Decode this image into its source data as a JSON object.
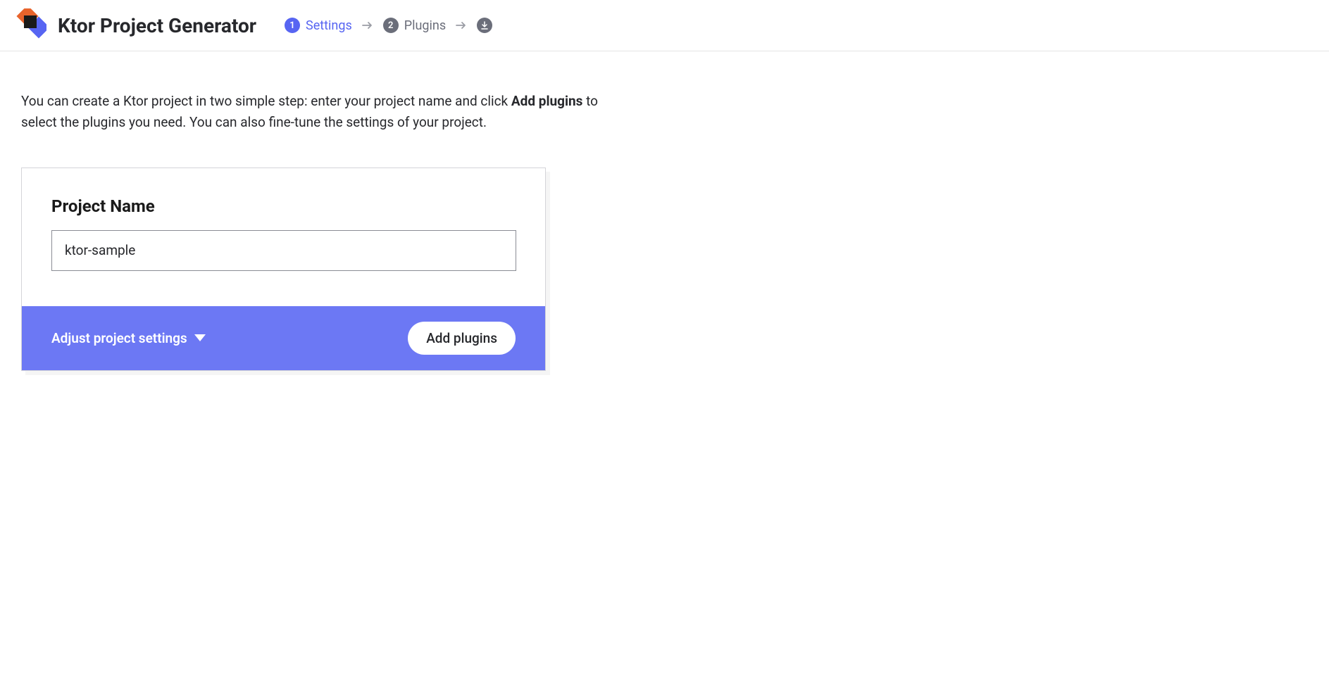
{
  "header": {
    "title": "Ktor Project Generator",
    "steps": [
      {
        "num": "1",
        "label": "Settings",
        "state": "active"
      },
      {
        "num": "2",
        "label": "Plugins",
        "state": "inactive"
      }
    ]
  },
  "intro": {
    "part1": "You can create a Ktor project in two simple step: enter your project name and click ",
    "bold": "Add plugins",
    "part2": " to select the plugins you need. You can also fine-tune the settings of your project."
  },
  "form": {
    "project_name_label": "Project Name",
    "project_name_value": "ktor-sample"
  },
  "footer": {
    "adjust_label": "Adjust project settings",
    "add_plugins_label": "Add plugins"
  }
}
